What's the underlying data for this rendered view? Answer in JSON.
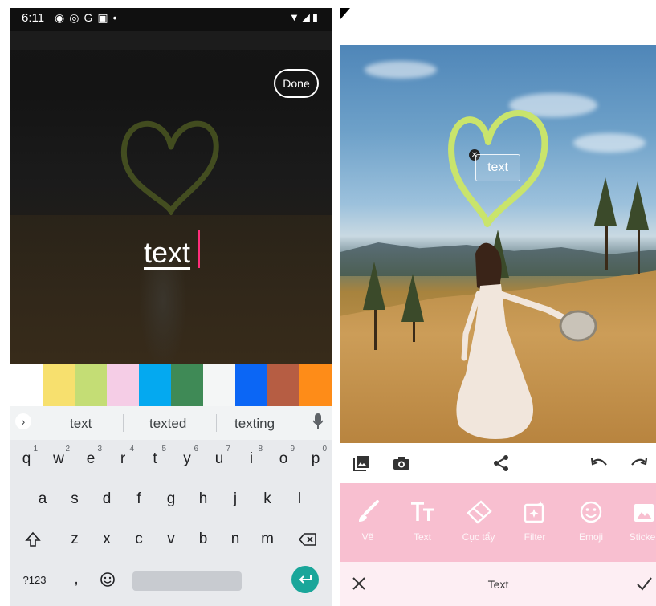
{
  "left_screen": {
    "status": {
      "time": "6:11",
      "indicator_icons": [
        "messenger-icon",
        "chrome-icon",
        "google-icon",
        "gmail-icon",
        "dot-icon"
      ],
      "right_icons": [
        "wifi-icon",
        "signal-icon",
        "battery-icon"
      ]
    },
    "done_label": "Done",
    "edit_text": "text",
    "palette": [
      "#ffffff",
      "#f7e06e",
      "#c4dd75",
      "#f5cde6",
      "#04a9f0",
      "#3f8a56",
      "#f4f6f6",
      "#0b66f5",
      "#b65d43",
      "#fe8c18"
    ],
    "keyboard": {
      "suggestions": [
        "text",
        "texted",
        "texting"
      ],
      "row1": [
        {
          "k": "q",
          "n": "1"
        },
        {
          "k": "w",
          "n": "2"
        },
        {
          "k": "e",
          "n": "3"
        },
        {
          "k": "r",
          "n": "4"
        },
        {
          "k": "t",
          "n": "5"
        },
        {
          "k": "y",
          "n": "6"
        },
        {
          "k": "u",
          "n": "7"
        },
        {
          "k": "i",
          "n": "8"
        },
        {
          "k": "o",
          "n": "9"
        },
        {
          "k": "p",
          "n": "0"
        }
      ],
      "row2": [
        "a",
        "s",
        "d",
        "f",
        "g",
        "h",
        "j",
        "k",
        "l"
      ],
      "row3": [
        "z",
        "x",
        "c",
        "v",
        "b",
        "n",
        "m"
      ],
      "symbols_label": "?123",
      "comma_label": ","
    }
  },
  "right_screen": {
    "sticker_text": "text",
    "tools": [
      {
        "icon": "brush-icon",
        "label": "Vẽ"
      },
      {
        "icon": "text-icon",
        "label": "Text"
      },
      {
        "icon": "eraser-icon",
        "label": "Cục tẩy"
      },
      {
        "icon": "filter-icon",
        "label": "Filter"
      },
      {
        "icon": "emoji-icon",
        "label": "Emoji"
      },
      {
        "icon": "sticker-icon",
        "label": "Sticker"
      }
    ],
    "bottom_title": "Text",
    "accent_pink": "#f8bfd0",
    "heart_color": "#c9e46c"
  }
}
